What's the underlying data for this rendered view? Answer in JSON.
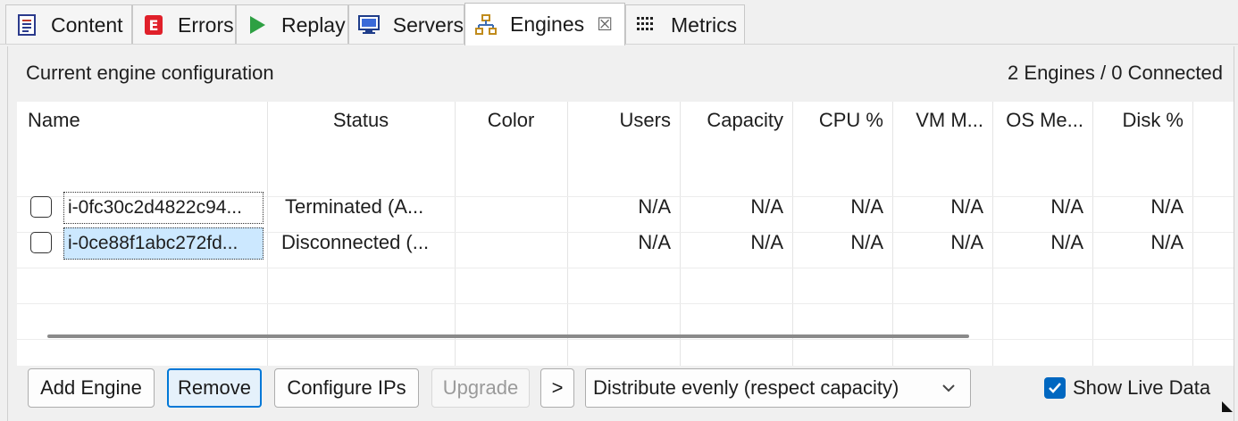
{
  "tabs": [
    {
      "label": "Content",
      "icon": "document-icon"
    },
    {
      "label": "Errors",
      "icon": "error-icon"
    },
    {
      "label": "Replay",
      "icon": "play-icon"
    },
    {
      "label": "Servers",
      "icon": "monitor-icon"
    },
    {
      "label": "Engines",
      "icon": "engines-icon",
      "active": true,
      "close_symbol": "☒"
    },
    {
      "label": "Metrics",
      "icon": "metrics-icon"
    }
  ],
  "panel": {
    "config_label": "Current engine configuration",
    "engine_summary": "2 Engines / 0 Connected"
  },
  "table": {
    "columns": [
      "Name",
      "Status",
      "Color",
      "Users",
      "Capacity",
      "CPU %",
      "VM M...",
      "OS Me...",
      "Disk %"
    ],
    "rows": [
      {
        "checked": false,
        "name": "i-0fc30c2d4822c94...",
        "status": "Terminated (A...",
        "color": "",
        "users": "N/A",
        "capacity": "N/A",
        "cpu": "N/A",
        "vm_mem": "N/A",
        "os_mem": "N/A",
        "disk": "N/A"
      },
      {
        "checked": false,
        "name": "i-0ce88f1abc272fd...",
        "status": "Disconnected (...",
        "color": "",
        "users": "N/A",
        "capacity": "N/A",
        "cpu": "N/A",
        "vm_mem": "N/A",
        "os_mem": "N/A",
        "disk": "N/A"
      }
    ]
  },
  "buttons": {
    "add_engine": "Add Engine",
    "remove": "Remove",
    "configure_ips": "Configure IPs",
    "upgrade": "Upgrade",
    "more": ">"
  },
  "distribution": {
    "selected": "Distribute evenly (respect capacity)"
  },
  "show_live_data": {
    "label": "Show Live Data",
    "checked": true
  },
  "colors": {
    "accent": "#0078d7",
    "selection": "#cce8ff",
    "checkbox_checked": "#0067c0"
  }
}
